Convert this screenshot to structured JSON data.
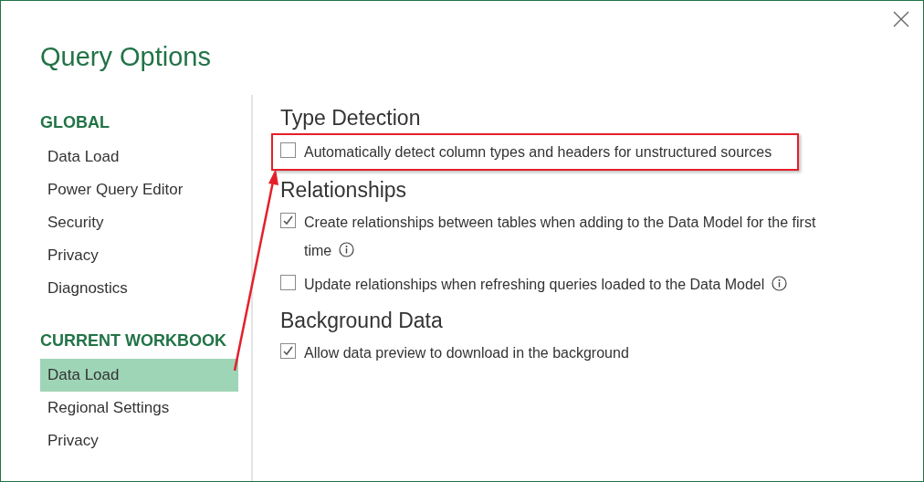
{
  "dialog": {
    "title": "Query Options"
  },
  "sidebar": [
    {
      "heading": "GLOBAL",
      "items": [
        {
          "label": "Data Load",
          "selected": false
        },
        {
          "label": "Power Query Editor",
          "selected": false
        },
        {
          "label": "Security",
          "selected": false
        },
        {
          "label": "Privacy",
          "selected": false
        },
        {
          "label": "Diagnostics",
          "selected": false
        }
      ]
    },
    {
      "heading": "CURRENT WORKBOOK",
      "items": [
        {
          "label": "Data Load",
          "selected": true
        },
        {
          "label": "Regional Settings",
          "selected": false
        },
        {
          "label": "Privacy",
          "selected": false
        }
      ]
    }
  ],
  "sections": [
    {
      "heading": "Type Detection",
      "options": [
        {
          "label": "Automatically detect column types and headers for unstructured sources",
          "checked": false,
          "info": false,
          "highlighted": true
        }
      ]
    },
    {
      "heading": "Relationships",
      "options": [
        {
          "label": "Create relationships between tables when adding to the Data Model for the first time",
          "checked": true,
          "info": true,
          "highlighted": false
        },
        {
          "label": "Update relationships when refreshing queries loaded to the Data Model",
          "checked": false,
          "info": true,
          "highlighted": false
        }
      ]
    },
    {
      "heading": "Background Data",
      "options": [
        {
          "label": "Allow data preview to download in the background",
          "checked": true,
          "info": false,
          "highlighted": false
        }
      ]
    }
  ]
}
